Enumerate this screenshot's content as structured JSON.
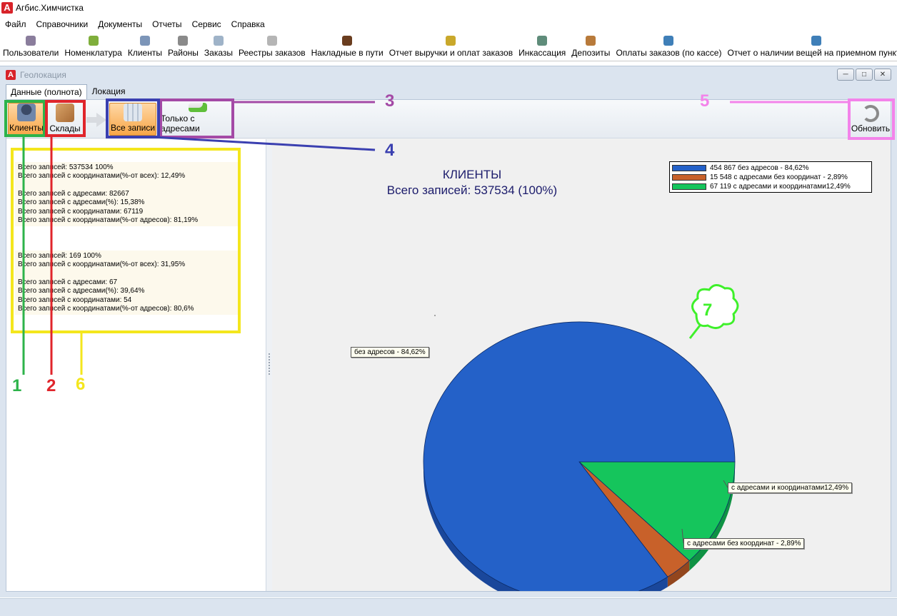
{
  "app": {
    "title": "Агбис.Химчистка",
    "logo_letter": "A"
  },
  "menu": [
    "Файл",
    "Справочники",
    "Документы",
    "Отчеты",
    "Сервис",
    "Справка"
  ],
  "toolbar": [
    {
      "label": "Пользователи",
      "icon": "users-icon",
      "color": "#8a7d9c"
    },
    {
      "label": "Номенклатура",
      "icon": "nomenclature-icon",
      "color": "#7fae3b"
    },
    {
      "label": "Клиенты",
      "icon": "client-icon",
      "color": "#7c95b8"
    },
    {
      "label": "Районы",
      "icon": "districts-icon",
      "color": "#8a8a8a"
    },
    {
      "label": "Заказы",
      "icon": "orders-icon",
      "color": "#9fb3c8"
    },
    {
      "label": "Реестры заказов",
      "icon": "registry-icon",
      "color": "#b5b5b5"
    },
    {
      "label": "Накладные в пути",
      "icon": "truck-icon",
      "color": "#6a3d1f"
    },
    {
      "label": "Отчет выручки и оплат заказов",
      "icon": "revenue-icon",
      "color": "#c9a82b"
    },
    {
      "label": "Инкассация",
      "icon": "encashment-icon",
      "color": "#5f8c7a"
    },
    {
      "label": "Депозиты",
      "icon": "deposit-icon",
      "color": "#b87a3a"
    },
    {
      "label": "Оплаты заказов (по кассе)",
      "icon": "payments-icon",
      "color": "#3f7fb8"
    },
    {
      "label": "Отчет о наличии вещей на приемном пункте",
      "icon": "stock-report-icon",
      "color": "#3f7fb8"
    }
  ],
  "window": {
    "title": "Геолокация"
  },
  "tabs": [
    "Данные (полнота)",
    "Локация"
  ],
  "module": {
    "clients": "Клиенты",
    "warehouses": "Склады",
    "all_records": "Все записи",
    "with_addresses": "Только с адресами",
    "refresh": "Обновить"
  },
  "stats": [
    {
      "lines": [
        "Всего записей: 537534 100%",
        "Всего записей с координатами(%-от всех): 12,49%",
        "",
        "Всего записей с адресами: 82667",
        "Всего записей с адресами(%): 15,38%",
        "Всего записей с координатами: 67119",
        "Всего записей с координатами(%-от адресов): 81,19%"
      ]
    },
    {
      "lines": [
        "Всего записей: 169 100%",
        "Всего записей с координатами(%-от всех): 31,95%",
        "",
        "Всего записей с адресами: 67",
        "Всего записей с адресами(%): 39,64%",
        "Всего записей с координатами: 54",
        "Всего записей с координатами(%-от адресов): 80,6%"
      ]
    }
  ],
  "chart_data": {
    "type": "pie",
    "title": "КЛИЕНТЫ",
    "subtitle": "Всего записей: 537534 (100%)",
    "series": [
      {
        "legend": "454 867 без адресов - 84,62%",
        "label": "без адресов - 84,62%",
        "value": 84.62,
        "color": "#2461c8",
        "dark": "#1a479b"
      },
      {
        "legend": "15 548 с адресами без координат - 2,89%",
        "label": "с адресами без координат - 2,89%",
        "value": 2.89,
        "color": "#c8612a",
        "dark": "#93461d"
      },
      {
        "legend": "67 119 с адресами и координатами12,49%",
        "label": "с адресами и координатами12,49%",
        "value": 12.49,
        "color": "#15c55c",
        "dark": "#0f9244"
      }
    ],
    "legend_position": "top-right"
  },
  "annotations": [
    "1",
    "2",
    "3",
    "4",
    "5",
    "6",
    "7"
  ],
  "colors": {
    "anno_green": "#2db34a",
    "anno_red": "#e0252b",
    "anno_purple": "#a44aa6",
    "anno_blue": "#3a3fb0",
    "anno_pink": "#f383ea",
    "anno_yellow": "#f4e61d",
    "anno_lime": "#3ef02a"
  }
}
